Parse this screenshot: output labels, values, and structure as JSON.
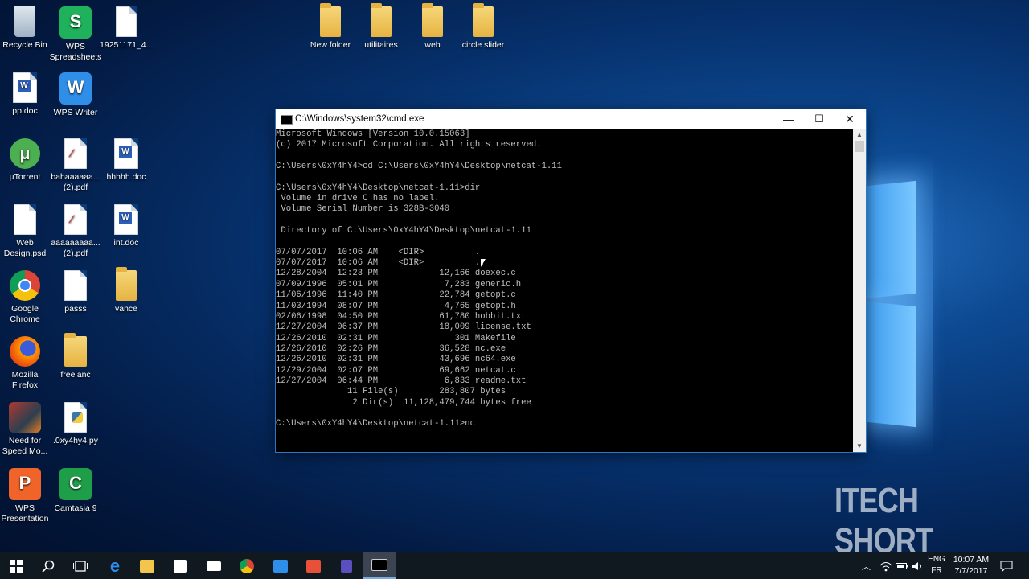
{
  "desktop": {
    "icons": [
      {
        "label": "Recycle Bin",
        "icon": "recycle-bin-icon"
      },
      {
        "label": "WPS\nSpreadsheets",
        "icon": "wps-spreadsheets-icon"
      },
      {
        "label": "19251171_4...",
        "icon": "file-icon"
      },
      {
        "label": "pp.doc",
        "icon": "word-doc-icon"
      },
      {
        "label": "WPS Writer",
        "icon": "wps-writer-icon"
      },
      {
        "label": "µTorrent",
        "icon": "utorrent-icon"
      },
      {
        "label": "bahaaaaaa...\n(2).pdf",
        "icon": "pdf-icon"
      },
      {
        "label": "hhhhh.doc",
        "icon": "word-doc-icon"
      },
      {
        "label": "Web\nDesign.psd",
        "icon": "file-icon"
      },
      {
        "label": "aaaaaaaaa...\n(2).pdf",
        "icon": "pdf-icon"
      },
      {
        "label": "int.doc",
        "icon": "word-doc-icon"
      },
      {
        "label": "Google\nChrome",
        "icon": "chrome-icon"
      },
      {
        "label": "passs",
        "icon": "file-icon"
      },
      {
        "label": "vance",
        "icon": "folder-icon"
      },
      {
        "label": "Mozilla\nFirefox",
        "icon": "firefox-icon"
      },
      {
        "label": "freelanc",
        "icon": "folder-icon"
      },
      {
        "label": "Need for\nSpeed Mo...",
        "icon": "game-icon"
      },
      {
        "label": ".0xy4hy4.py",
        "icon": "python-file-icon"
      },
      {
        "label": "WPS\nPresentation",
        "icon": "wps-presentation-icon"
      },
      {
        "label": "Camtasia 9",
        "icon": "camtasia-icon"
      },
      {
        "label": "New folder",
        "icon": "folder-icon"
      },
      {
        "label": "utilitaires",
        "icon": "folder-icon"
      },
      {
        "label": "web",
        "icon": "folder-icon"
      },
      {
        "label": "circle slider",
        "icon": "folder-icon"
      }
    ]
  },
  "cmd": {
    "title": "C:\\Windows\\system32\\cmd.exe",
    "lines": [
      "Microsoft Windows [Version 10.0.15063]",
      "(c) 2017 Microsoft Corporation. All rights reserved.",
      "",
      "C:\\Users\\0xY4hY4>cd C:\\Users\\0xY4hY4\\Desktop\\netcat-1.11",
      "",
      "C:\\Users\\0xY4hY4\\Desktop\\netcat-1.11>dir",
      " Volume in drive C has no label.",
      " Volume Serial Number is 328B-3040",
      "",
      " Directory of C:\\Users\\0xY4hY4\\Desktop\\netcat-1.11",
      "",
      "07/07/2017  10:06 AM    <DIR>          .",
      "07/07/2017  10:06 AM    <DIR>          ..",
      "12/28/2004  12:23 PM            12,166 doexec.c",
      "07/09/1996  05:01 PM             7,283 generic.h",
      "11/06/1996  11:40 PM            22,784 getopt.c",
      "11/03/1994  08:07 PM             4,765 getopt.h",
      "02/06/1998  04:50 PM            61,780 hobbit.txt",
      "12/27/2004  06:37 PM            18,009 license.txt",
      "12/26/2010  02:31 PM               301 Makefile",
      "12/26/2010  02:26 PM            36,528 nc.exe",
      "12/26/2010  02:31 PM            43,696 nc64.exe",
      "12/29/2004  02:07 PM            69,662 netcat.c",
      "12/27/2004  06:44 PM             6,833 readme.txt",
      "              11 File(s)        283,807 bytes",
      "               2 Dir(s)  11,128,479,744 bytes free",
      "",
      "C:\\Users\\0xY4hY4\\Desktop\\netcat-1.11>nc"
    ],
    "buttons": {
      "minimize": "—",
      "maximize": "☐",
      "close": "✕"
    }
  },
  "watermark": "ITECH SHORT",
  "taskbar": {
    "language": "ENG",
    "layout": "FR",
    "time": "10:07 AM",
    "date": "7/7/2017"
  }
}
